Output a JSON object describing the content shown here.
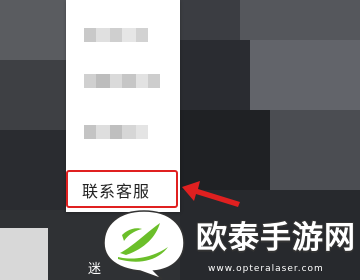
{
  "context_menu": {
    "items": [
      {
        "label": "",
        "obscured": true
      },
      {
        "label": "",
        "obscured": true
      },
      {
        "label": "",
        "obscured": true
      },
      {
        "label": "联系客服",
        "highlighted": true
      }
    ]
  },
  "bottom_text": "迷",
  "watermark": {
    "name": "欧泰手游网",
    "url": "www.opteralaser.com"
  },
  "colors": {
    "highlight": "#e02020",
    "logo_green": "#6bbf2a",
    "logo_white": "#ffffff"
  },
  "icons": [
    "arrow-icon",
    "leaf-logo-icon"
  ]
}
